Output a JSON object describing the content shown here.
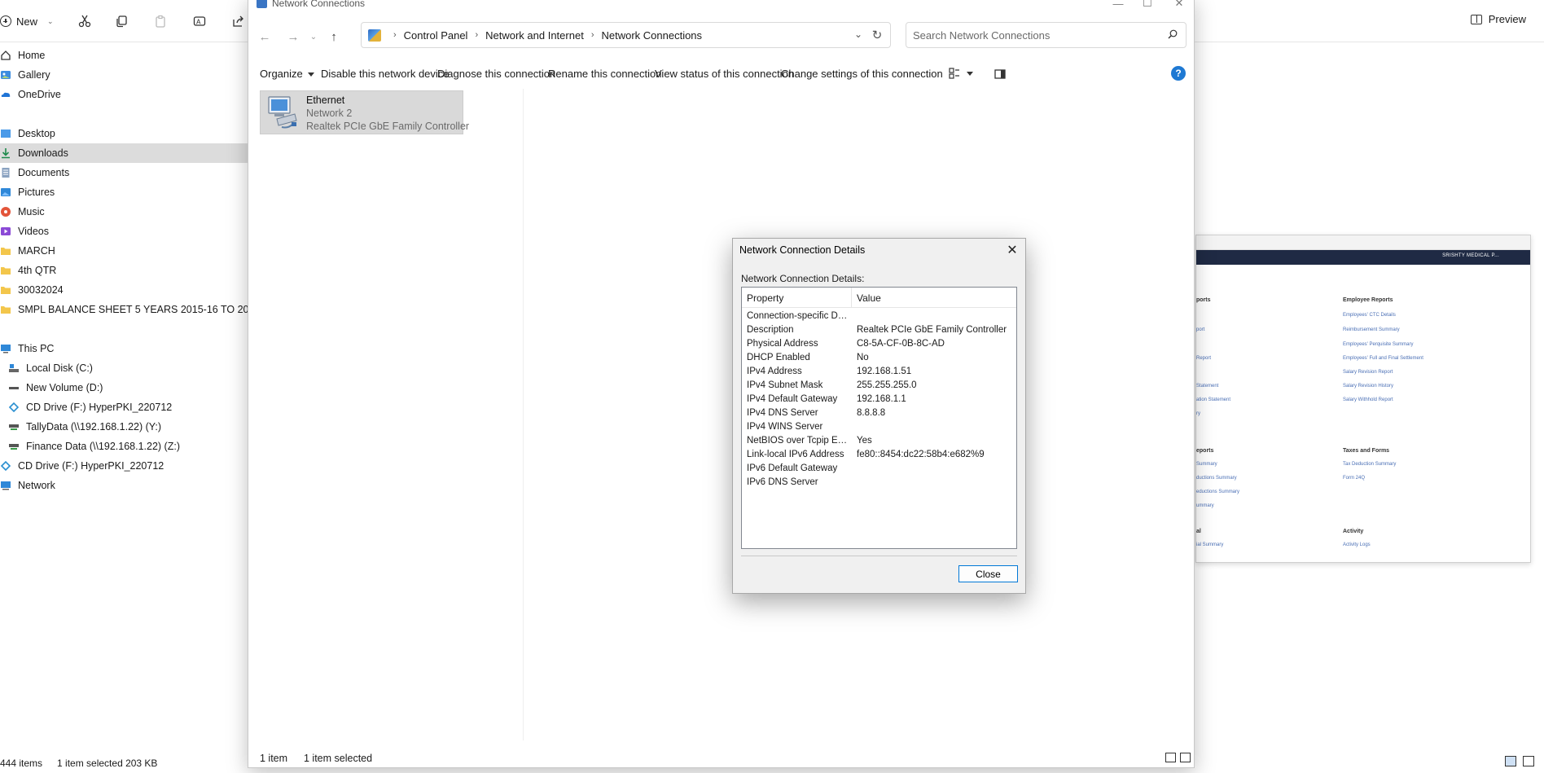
{
  "explorer": {
    "new_label": "New",
    "preview_label": "Preview",
    "nav_items": [
      {
        "label": "Home",
        "icon": "home-icon"
      },
      {
        "label": "Gallery",
        "icon": "gallery-icon"
      },
      {
        "label": "OneDrive",
        "icon": "onedrive-icon"
      },
      {
        "label": "Desktop",
        "icon": "desktop-icon"
      },
      {
        "label": "Downloads",
        "icon": "downloads-icon"
      },
      {
        "label": "Documents",
        "icon": "documents-icon"
      },
      {
        "label": "Pictures",
        "icon": "pictures-icon"
      },
      {
        "label": "Music",
        "icon": "music-icon"
      },
      {
        "label": "Videos",
        "icon": "videos-icon"
      },
      {
        "label": "MARCH",
        "icon": "folder-icon"
      },
      {
        "label": "4th QTR",
        "icon": "folder-icon"
      },
      {
        "label": "30032024",
        "icon": "folder-icon"
      },
      {
        "label": "SMPL BALANCE SHEET 5  YEARS 2015-16 TO 2020-21",
        "icon": "folder-icon"
      },
      {
        "label": "This PC",
        "icon": "this-pc-icon"
      },
      {
        "label": "Local Disk (C:)",
        "icon": "drive-icon"
      },
      {
        "label": "New Volume (D:)",
        "icon": "drive-icon"
      },
      {
        "label": "CD Drive (F:) HyperPKI_220712",
        "icon": "cd-drive-icon"
      },
      {
        "label": "TallyData (\\\\192.168.1.22) (Y:)",
        "icon": "network-drive-icon"
      },
      {
        "label": "Finance Data (\\\\192.168.1.22) (Z:)",
        "icon": "network-drive-icon"
      },
      {
        "label": "CD Drive (F:) HyperPKI_220712",
        "icon": "cd-drive-icon"
      },
      {
        "label": "Network",
        "icon": "network-icon"
      }
    ],
    "status": {
      "items": "444 items",
      "selected": "1 item selected  203 KB"
    }
  },
  "browser_thumb": {
    "brand": "SRISHTY MEDICAL P...",
    "sections": [
      {
        "title": "ports",
        "links": [
          "",
          "port",
          "",
          "Report",
          "Statement",
          "ation Statement",
          "ry"
        ]
      },
      {
        "title": "Employee Reports",
        "links": [
          "Employees' CTC Details",
          "Reimbursement Summary",
          "Employees' Perquisite Summary",
          "Employees' Full and Final Settlement",
          "Salary Revision Report",
          "Salary Revision History",
          "Salary Withhold Report"
        ]
      },
      {
        "title": "eports",
        "links": [
          "Summary",
          "ductions Summary",
          "eductions Summary",
          "ummary"
        ]
      },
      {
        "title": "Taxes and Forms",
        "links": [
          "Tax Deduction Summary",
          "Form 24Q"
        ]
      },
      {
        "title": "al",
        "links": [
          "ial Summary"
        ]
      },
      {
        "title": "Activity",
        "links": [
          "Activity Logs"
        ]
      }
    ]
  },
  "nc_window": {
    "title": "Network Connections",
    "breadcrumbs": [
      "Control Panel",
      "Network and Internet",
      "Network Connections"
    ],
    "search_placeholder": "Search Network Connections",
    "commands": {
      "organize": "Organize",
      "disable": "Disable this network device",
      "diagnose": "Diagnose this connection",
      "rename": "Rename this connection",
      "view_status": "View status of this connection",
      "change_settings": "Change settings of this connection"
    },
    "adapter": {
      "name": "Ethernet",
      "network": "Network 2",
      "device": "Realtek PCIe GbE Family Controller"
    },
    "status": {
      "count": "1 item",
      "selected": "1 item selected"
    }
  },
  "dialog": {
    "title": "Network Connection Details",
    "label": "Network Connection Details:",
    "columns": {
      "property": "Property",
      "value": "Value"
    },
    "rows": [
      {
        "property": "Connection-specific DN...",
        "value": ""
      },
      {
        "property": "Description",
        "value": "Realtek PCIe GbE Family Controller"
      },
      {
        "property": "Physical Address",
        "value": "C8-5A-CF-0B-8C-AD"
      },
      {
        "property": "DHCP Enabled",
        "value": "No"
      },
      {
        "property": "IPv4 Address",
        "value": "192.168.1.51"
      },
      {
        "property": "IPv4 Subnet Mask",
        "value": "255.255.255.0"
      },
      {
        "property": "IPv4 Default Gateway",
        "value": "192.168.1.1"
      },
      {
        "property": "IPv4 DNS Server",
        "value": "8.8.8.8"
      },
      {
        "property": "IPv4 WINS Server",
        "value": ""
      },
      {
        "property": "NetBIOS over Tcpip En...",
        "value": "Yes"
      },
      {
        "property": "Link-local IPv6 Address",
        "value": "fe80::8454:dc22:58b4:e682%9"
      },
      {
        "property": "IPv6 Default Gateway",
        "value": ""
      },
      {
        "property": "IPv6 DNS Server",
        "value": ""
      }
    ],
    "close_label": "Close"
  }
}
